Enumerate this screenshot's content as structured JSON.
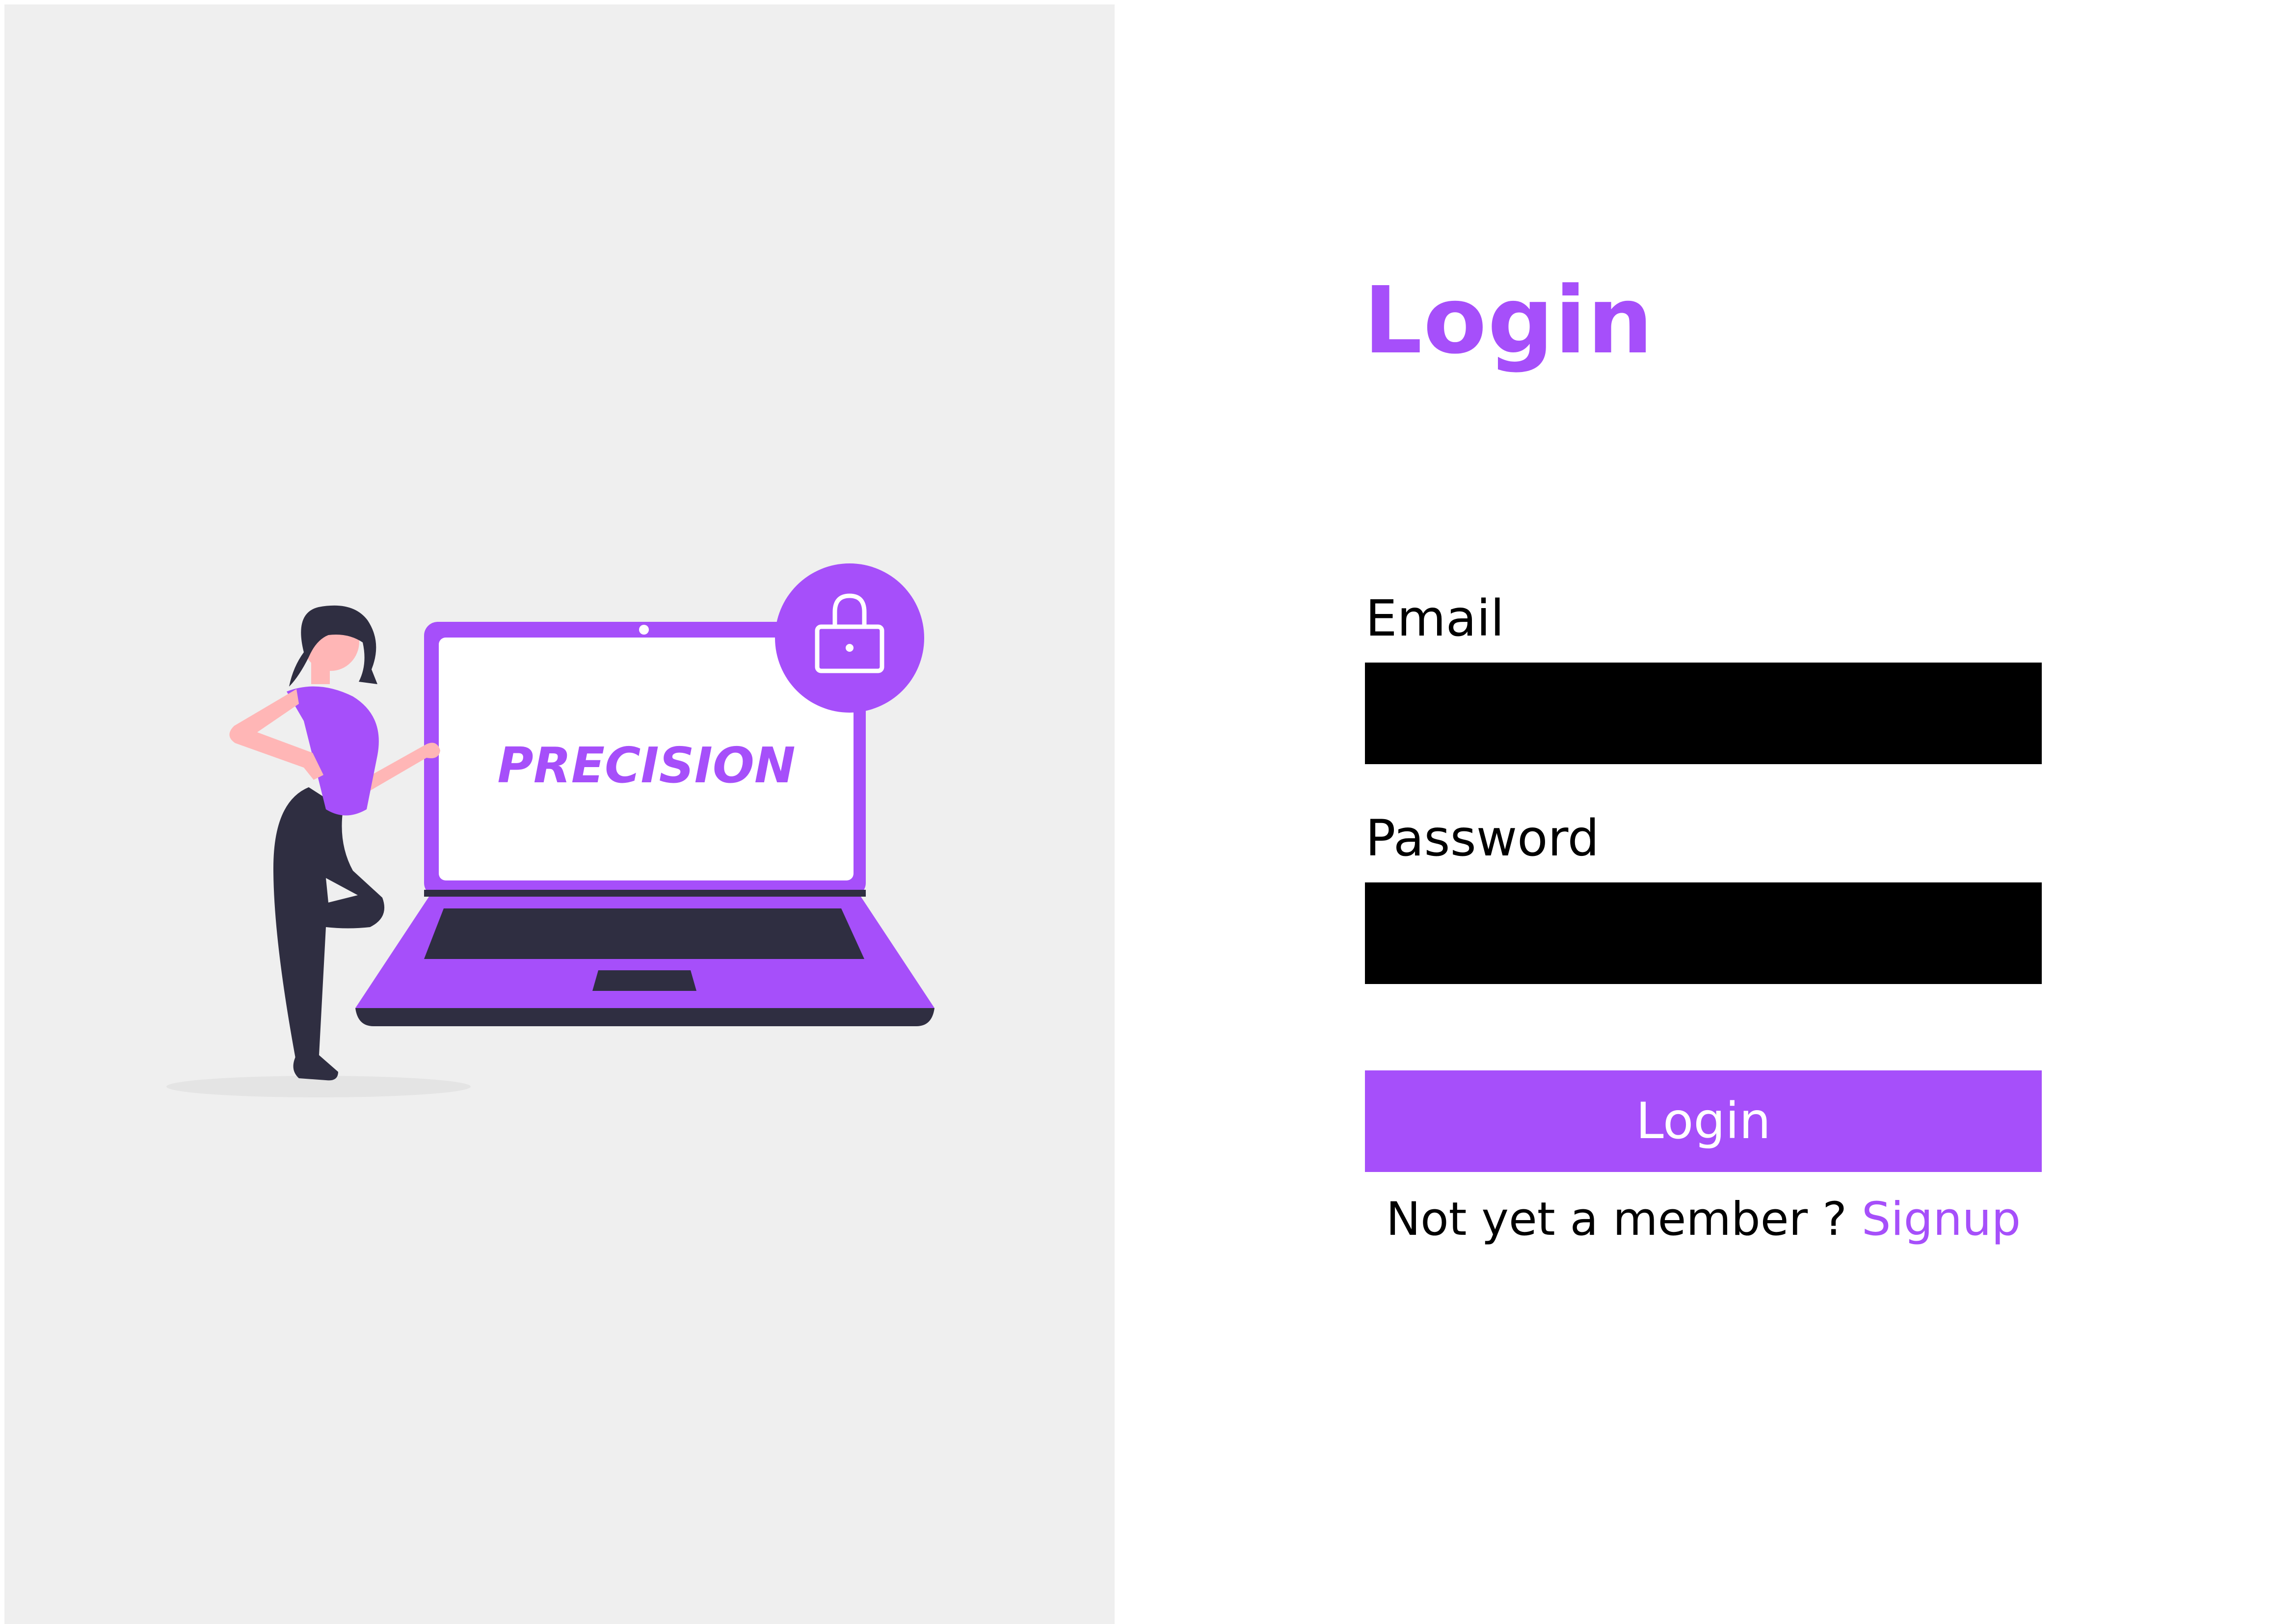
{
  "brand": {
    "logo_text": "PRECISION",
    "accent_color": "#a64ffa",
    "dark_color": "#2f2e41"
  },
  "illustration": {
    "icons": [
      "person-figure",
      "laptop-icon",
      "padlock-icon"
    ]
  },
  "form": {
    "title": "Login",
    "email": {
      "label": "Email",
      "value": "",
      "field_color": "#000000"
    },
    "password": {
      "label": "Password",
      "value": "",
      "field_color": "#000000"
    },
    "submit_label": "Login",
    "signup_prompt": "Not yet a member ?",
    "signup_link": "Signup"
  }
}
